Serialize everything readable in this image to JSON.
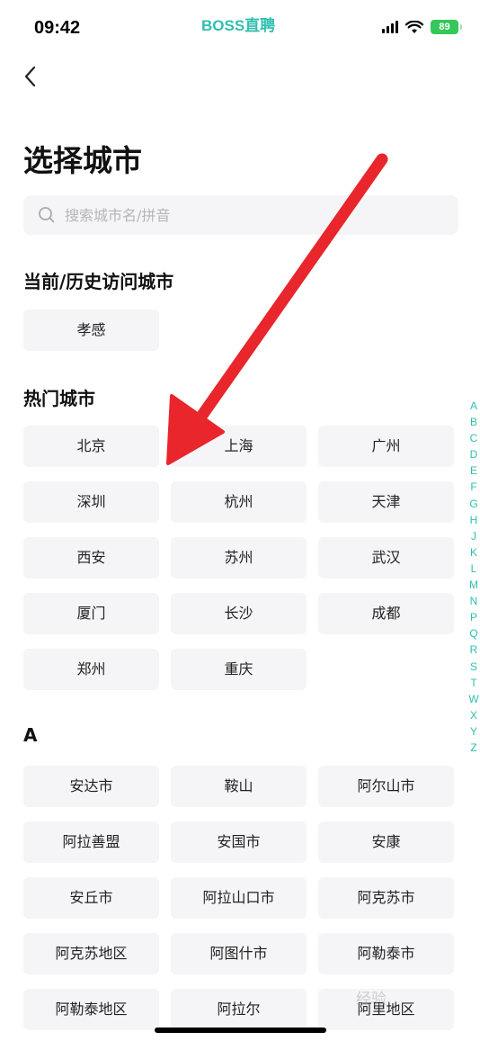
{
  "status_bar": {
    "time": "09:42",
    "app_name": "BOSS直聘",
    "battery": "89"
  },
  "page": {
    "title": "选择城市",
    "search_placeholder": "搜索城市名/拼音"
  },
  "sections": {
    "history_title": "当前/历史访问城市",
    "history_cities": [
      "孝感"
    ],
    "hot_title": "热门城市",
    "hot_cities": [
      "北京",
      "上海",
      "广州",
      "深圳",
      "杭州",
      "天津",
      "西安",
      "苏州",
      "武汉",
      "厦门",
      "长沙",
      "成都",
      "郑州",
      "重庆"
    ],
    "a_title": "A",
    "a_cities": [
      "安达市",
      "鞍山",
      "阿尔山市",
      "阿拉善盟",
      "安国市",
      "安康",
      "安丘市",
      "阿拉山口市",
      "阿克苏市",
      "阿克苏地区",
      "阿图什市",
      "阿勒泰市",
      "阿勒泰地区",
      "阿拉尔",
      "阿里地区"
    ]
  },
  "alpha_index": [
    "A",
    "B",
    "C",
    "D",
    "E",
    "F",
    "G",
    "H",
    "J",
    "K",
    "L",
    "M",
    "N",
    "P",
    "Q",
    "R",
    "S",
    "T",
    "W",
    "X",
    "Y",
    "Z"
  ],
  "colors": {
    "accent": "#2fbfb0",
    "button_bg": "#f5f5f7",
    "annotation_arrow": "#e8262b"
  },
  "watermark": "经验"
}
